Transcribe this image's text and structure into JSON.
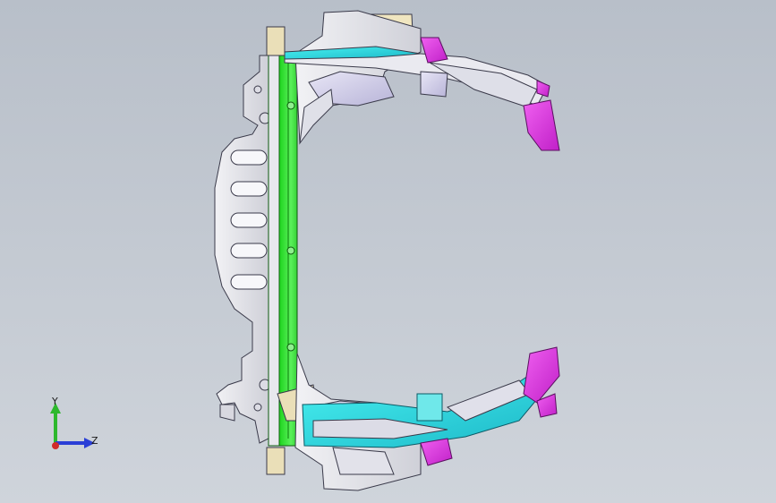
{
  "viewport": {
    "background_top": "#b8bfc9",
    "background_bottom": "#cfd4db"
  },
  "model": {
    "description_colors": {
      "structure_gray": "#e6e6ea",
      "crossmember_green": "#2ee62e",
      "rail_cyan": "#33e0e0",
      "bracket_magenta": "#e23ee2",
      "panel_beige": "#eadfb8",
      "edge_dark": "#3a3a4a"
    }
  },
  "triad": {
    "y_label": "Y",
    "z_label": "Z",
    "y_color": "#2db82d",
    "z_color": "#2a3fd6",
    "x_color": "#d12a2a"
  }
}
